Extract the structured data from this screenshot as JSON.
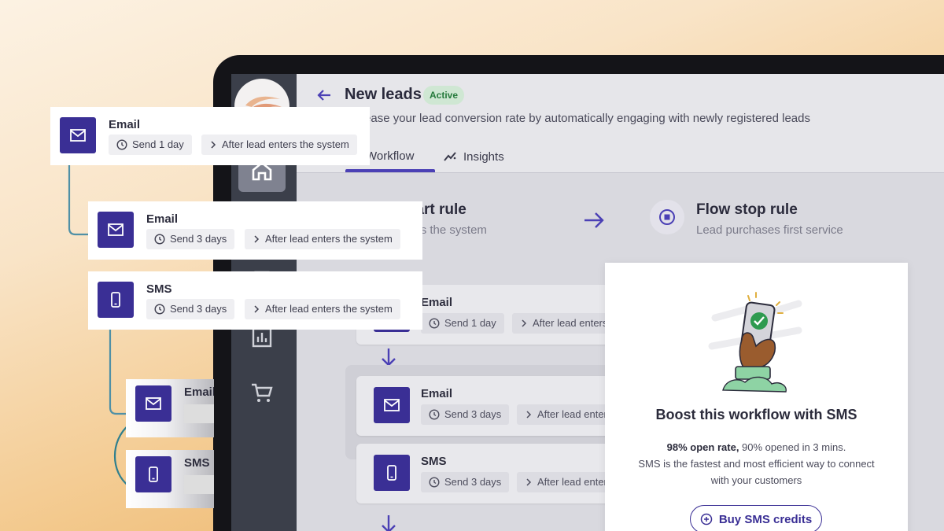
{
  "workflow": {
    "title": "New leads",
    "status": "Active",
    "description": "Increase your lead conversion rate by automatically engaging with newly registered leads",
    "tabs": [
      {
        "label": "Workflow",
        "active": true
      },
      {
        "label": "Insights",
        "active": false
      }
    ]
  },
  "rules": {
    "start": {
      "title": "Flow start rule",
      "subtitle": "Lead enters the system"
    },
    "stop": {
      "title": "Flow stop rule",
      "subtitle": "Lead purchases first service"
    }
  },
  "steps": [
    {
      "type": "Email",
      "icon": "mail-icon",
      "delay": "Send 1 day",
      "trigger": "After lead enters the system"
    },
    {
      "type": "Email",
      "icon": "mail-icon",
      "delay": "Send 3 days",
      "trigger": "After lead enters the system"
    },
    {
      "type": "SMS",
      "icon": "phone-icon",
      "delay": "Send 3 days",
      "trigger": "After lead enters the system"
    }
  ],
  "sms_promo": {
    "heading": "Boost this workflow with SMS",
    "stat_bold": "98% open rate,",
    "stat_rest": " 90% opened in 3 mins.",
    "line2": "SMS is the fastest and most efficient way to connect",
    "line3": "with your customers",
    "button": "Buy SMS credits"
  },
  "nav": {
    "items": [
      "logo",
      "home-icon",
      "calendar-icon",
      "chart-icon",
      "cart-icon"
    ]
  },
  "colors": {
    "accent": "#3a2f95",
    "status_green": "#267a3c",
    "sidebar": "#3b3f4a"
  }
}
